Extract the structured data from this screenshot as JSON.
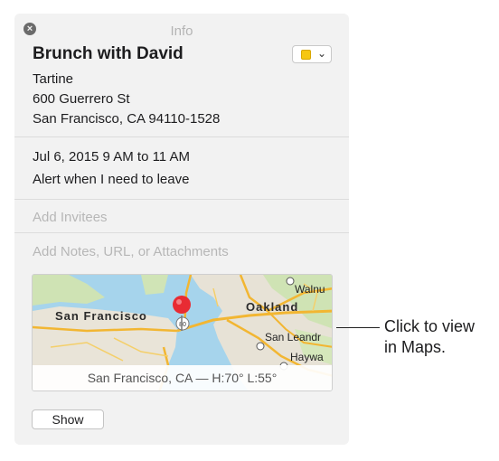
{
  "panel": {
    "title": "Info",
    "close_icon": "close-icon",
    "event_title": "Brunch with David",
    "calendar_color": "#f6c711",
    "chevron": "⌄",
    "location": {
      "name": "Tartine",
      "street": "600 Guerrero St",
      "city": "San Francisco, CA  94110-1528"
    },
    "datetime": "Jul 6, 2015  9 AM to 11 AM",
    "alert": "Alert when I need to leave",
    "invitees_placeholder": "Add Invitees",
    "notes_placeholder": "Add Notes, URL, or Attachments",
    "map": {
      "labels": {
        "san_francisco": "San Francisco",
        "oakland": "Oakland",
        "walnut": "Walnu",
        "san_leandro": "San Leandr",
        "hayward": "Haywa"
      },
      "highway_shield": "80",
      "caption": "San Francisco, CA — H:70° L:55°"
    },
    "show_button": "Show"
  },
  "callout": {
    "line1": "Click to view",
    "line2": "in Maps."
  }
}
